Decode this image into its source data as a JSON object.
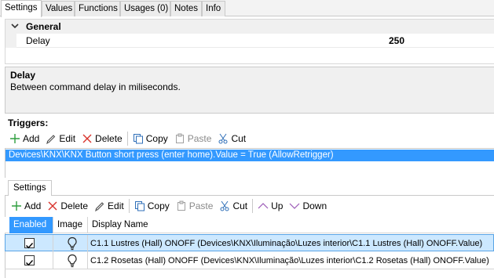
{
  "tabs": [
    {
      "label": "Settings"
    },
    {
      "label": "Values"
    },
    {
      "label": "Functions"
    },
    {
      "label": "Usages (0)"
    },
    {
      "label": "Notes"
    },
    {
      "label": "Info"
    }
  ],
  "property_grid": {
    "category": "General",
    "rows": [
      {
        "name": "Delay",
        "value": "250"
      }
    ]
  },
  "description": {
    "title": "Delay",
    "text": "Between command delay in miliseconds."
  },
  "triggers": {
    "label": "Triggers:",
    "toolbar": {
      "add": "Add",
      "edit": "Edit",
      "delete": "Delete",
      "copy": "Copy",
      "paste": "Paste",
      "cut": "Cut"
    },
    "items": [
      "Devices\\KNX\\KNX Button short press (enter home).Value = True (AllowRetrigger)"
    ]
  },
  "settings": {
    "tab_label": "Settings",
    "toolbar": {
      "add": "Add",
      "delete": "Delete",
      "edit": "Edit",
      "copy": "Copy",
      "paste": "Paste",
      "cut": "Cut",
      "up": "Up",
      "down": "Down"
    },
    "columns": [
      "Enabled",
      "Image",
      "Display Name"
    ],
    "rows": [
      {
        "enabled": true,
        "image": "lightbulb-icon",
        "display_name": "C1.1 Lustres (Hall) ONOFF (Devices\\KNX\\Iluminação\\Luzes interior\\C1.1 Lustres (Hall) ONOFF.Value)"
      },
      {
        "enabled": true,
        "image": "lightbulb-icon",
        "display_name": "C1.2 Rosetas (Hall) ONOFF (Devices\\KNX\\Iluminação\\Luzes interior\\C1.2 Rosetas (Hall) ONOFF.Value)"
      }
    ]
  },
  "colors": {
    "selection": "#3399ff",
    "row_selected": "#cce8ff",
    "add_green": "#2e9e3e",
    "delete_red": "#d9322b",
    "cut_blue": "#2f6fb8"
  }
}
